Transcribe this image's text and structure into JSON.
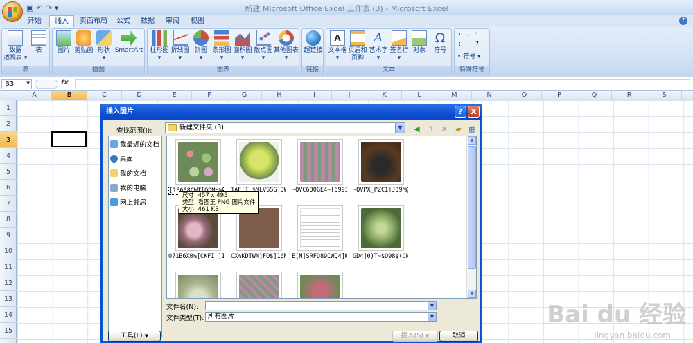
{
  "window": {
    "title": "新建 Microsoft Office Excel 工作表 (3) - Microsoft Excel"
  },
  "ribbon_tabs": [
    "开始",
    "插入",
    "页面布局",
    "公式",
    "数据",
    "审阅",
    "视图"
  ],
  "active_tab": "插入",
  "ribbon": {
    "groups": [
      {
        "label": "表",
        "buttons": [
          "数据\n透视表 ▾",
          "表"
        ]
      },
      {
        "label": "插图",
        "buttons": [
          "图片",
          "剪贴画",
          "形状\n▾",
          "SmartArt"
        ]
      },
      {
        "label": "图表",
        "buttons": [
          "柱形图\n▾",
          "折线图\n▾",
          "饼图\n▾",
          "条形图\n▾",
          "面积图\n▾",
          "散点图\n▾",
          "其他图表\n▾"
        ]
      },
      {
        "label": "链接",
        "buttons": [
          "超链接"
        ]
      },
      {
        "label": "文本",
        "buttons": [
          "文本框\n▾",
          "页眉和\n页脚",
          "艺术字\n▾",
          "签名行\n▾",
          "对象",
          "符号"
        ]
      },
      {
        "label": "特殊符号",
        "buttons": [
          "符号 ▾"
        ]
      }
    ]
  },
  "formula_bar": {
    "name_box": "B3",
    "fx": "fx",
    "formula": ""
  },
  "columns": [
    "A",
    "B",
    "C",
    "D",
    "E",
    "F",
    "G",
    "H",
    "I",
    "J",
    "K",
    "L",
    "M",
    "N",
    "O",
    "P",
    "Q",
    "R",
    "S"
  ],
  "selected_column": "B",
  "rows": [
    "1",
    "2",
    "3",
    "4",
    "5",
    "6",
    "7",
    "8",
    "9",
    "10",
    "11",
    "12",
    "13",
    "14",
    "15"
  ],
  "selected_row": "3",
  "dialog": {
    "title": "插入图片",
    "help": "?",
    "close": "X",
    "look_in_label": "查找范围(I):",
    "look_in_value": "新建文件夹 (3)",
    "places": [
      "我最近的文档",
      "桌面",
      "我的文档",
      "我的电脑",
      "网上邻居"
    ],
    "files": [
      {
        "name": "[1E608CWT[ODMH%K]3X..."
      },
      {
        "name": "1AE`T_$MLVSSG]DW..."
      },
      {
        "name": "~QVC6D0GE4~[69937..."
      },
      {
        "name": "~QVPX_PZC1]J39M@U..."
      },
      {
        "name": "071B6X0%[CKFI_]I)..."
      },
      {
        "name": "CX%KDTWN]FO$]16MO..."
      },
      {
        "name": "E(N]SRFQ89CWQ4]KL..."
      },
      {
        "name": "GD4]0)T~$Q98$(CN@..."
      },
      {
        "name": ""
      },
      {
        "name": ""
      },
      {
        "name": ""
      }
    ],
    "tooltip": {
      "size": "尺寸: 457 x 495",
      "type": "类型: 看图王 PNG 图片文件",
      "filesize": "大小: 461 KB"
    },
    "filename_label": "文件名(N):",
    "filename_value": "",
    "filetype_label": "文件类型(T):",
    "filetype_value": "所有图片",
    "tools_button": "工具(L)",
    "insert_button": "插入(S)",
    "cancel_button": "取消"
  },
  "watermark": {
    "text": "Bai du 经验",
    "url": "jingyan.baidu.com"
  },
  "colors": {
    "accent": "#0a53d6",
    "selection": "#f3b94f",
    "ribbon": "#d4e2f4"
  }
}
